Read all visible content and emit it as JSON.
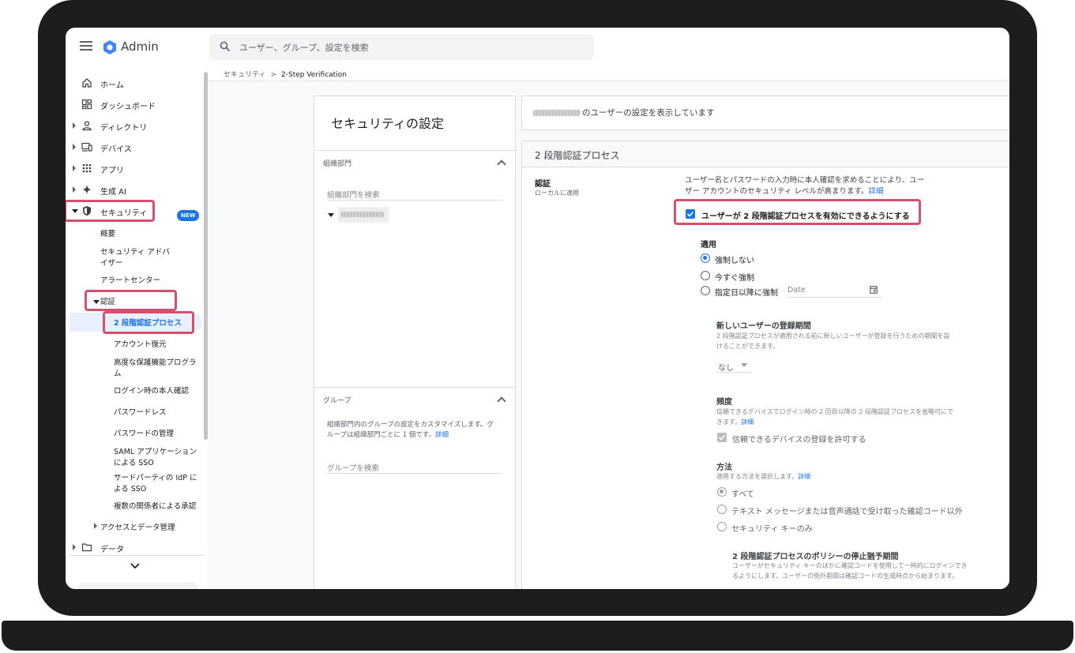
{
  "app": {
    "title": "Admin"
  },
  "search": {
    "placeholder": "ユーザー、グループ、設定を検索"
  },
  "breadcrumb": {
    "parent": "セキュリティ",
    "separator": ">",
    "current": "2-Step Verification"
  },
  "sidebar": {
    "items": [
      {
        "label": "ホーム",
        "icon": "home-icon"
      },
      {
        "label": "ダッシュボード",
        "icon": "dashboard-icon"
      },
      {
        "label": "ディレクトリ",
        "icon": "person-icon"
      },
      {
        "label": "デバイス",
        "icon": "devices-icon"
      },
      {
        "label": "アプリ",
        "icon": "apps-grid-icon"
      },
      {
        "label": "生成 AI",
        "icon": "sparkle-icon"
      },
      {
        "label": "セキュリティ",
        "icon": "shield-icon"
      }
    ],
    "security_sub": {
      "overview": "概要",
      "advisor_line1": "セキュリティ アドバ",
      "advisor_line2": "イザー",
      "new_badge": "NEW",
      "alert_center": "アラートセンター",
      "auth": "認証",
      "auth_items": {
        "two_step": "2 段階認証プロセス",
        "account_recovery": "アカウント復元",
        "advanced_line1": "高度な保護機能プログラ",
        "advanced_line2": "ム",
        "login_challenge": "ログイン時の本人確認",
        "passwordless": "パスワードレス",
        "password_mgmt": "パスワードの管理",
        "saml_line1": "SAML アプリケーション",
        "saml_line2": "による SSO",
        "third_party_line1": "サードパーティの IdP に",
        "third_party_line2": "よる SSO",
        "multi_party": "複数の関係者による承認"
      },
      "access_data": "アクセスとデータ管理"
    },
    "data_item": "データ"
  },
  "left_panel": {
    "title": "セキュリティの設定",
    "org_section": {
      "title": "組織部門",
      "search_placeholder": "組織部門を検索"
    },
    "group_section": {
      "title": "グループ",
      "desc_line1": "組織部門内のグループの設定をカスタマイズします。グ",
      "desc_line2": "ループは組織部門ごとに 1 個です。",
      "desc_link": "詳細",
      "search_placeholder": "グループを検索"
    }
  },
  "right_panel": {
    "viewing_text": "のユーザーの設定を表示しています",
    "section_title": "2 段階認証プロセス",
    "auth_label": "認証",
    "auth_sub": "ローカルに適用",
    "desc_line1": "ユーザー名とパスワードの入力時に本人確認を求めることにより、ユー",
    "desc_line2": "ザー アカウントのセキュリティ レベルが高まります。",
    "desc_link": "詳細",
    "allow_checkbox_label": "ユーザーが 2 段階認証プロセスを有効にできるようにする",
    "enforcement": {
      "title": "適用",
      "options": [
        "強制しない",
        "今すぐ強制",
        "指定日以降に強制"
      ],
      "selected": "強制しない",
      "date_placeholder": "Date"
    },
    "enrollment": {
      "title": "新しいユーザーの登録期間",
      "desc_line1": "2 段階認証プロセスが適用される前に新しいユーザーが登録を行うための期間を設",
      "desc_line2": "けることができます。",
      "value": "なし"
    },
    "frequency": {
      "title": "頻度",
      "desc_line1": "信頼できるデバイスでログイン時の 2 回目以降の 2 段階認証プロセスを省略可にで",
      "desc_line2": "きます。",
      "desc_link": "詳細",
      "checkbox_label": "信頼できるデバイスの登録を許可する"
    },
    "methods": {
      "title": "方法",
      "desc": "適用する方法を選択します。",
      "desc_link": "詳細",
      "options": [
        "すべて",
        "テキスト メッセージまたは音声通話で受け取った確認コード以外",
        "セキュリティ キーのみ"
      ],
      "selected": "すべて"
    },
    "suspension": {
      "title": "2 段階認証プロセスのポリシーの停止猶予期間",
      "desc_line1": "ユーザーがセキュリティ キーのほかに確認コードを使用して一時的にログインでき",
      "desc_line2": "るようにします。ユーザーの例外期間は確認コードの生成時点から始まります。"
    }
  },
  "colors": {
    "accent": "#1a73e8",
    "highlight": "#d5506c",
    "frame": "#1d1d1d"
  }
}
